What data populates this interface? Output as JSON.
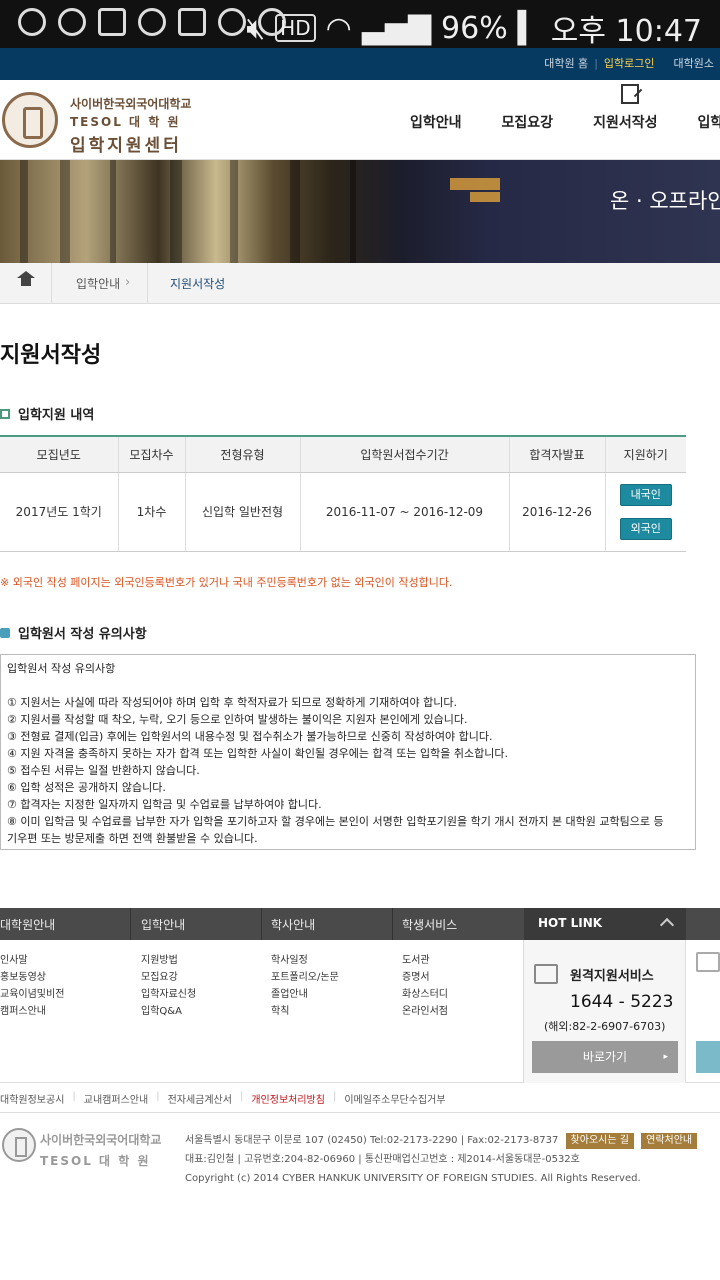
{
  "status_bar": {
    "battery": "96%",
    "time": "오후 10:47",
    "hd": "HD"
  },
  "topbar": {
    "links": [
      "대학원 홈",
      "입학로그인",
      "대학원소"
    ]
  },
  "header": {
    "logo_line1": "사이버한국외국어대학교",
    "logo_line2": "TESOL 대 학 원",
    "logo_line3": "입학지원센터",
    "nav": [
      "입학안내",
      "모집요강",
      "지원서작성",
      "입학상"
    ]
  },
  "banner": {
    "text": "온 · 오프라인"
  },
  "breadcrumb": {
    "item1": "입학안내",
    "item2": "지원서작성"
  },
  "page_title": "지원서작성",
  "section1": {
    "title": "입학지원 내역",
    "columns": [
      "모집년도",
      "모집차수",
      "전형유형",
      "입학원서접수기간",
      "합격자발표",
      "지원하기"
    ],
    "row": [
      "2017년도 1학기",
      "1차수",
      "신입학 일반전형",
      "2016-11-07 ~ 2016-12-09",
      "2016-12-26"
    ],
    "btn_domestic": "내국인",
    "btn_foreign": "외국인"
  },
  "notice": "※ 외국인 작성 페이지는 외국인등록번호가 있거나 국내 주민등록번호가 없는 외국인이 작성합니다.",
  "section2": {
    "title": "입학원서 작성 유의사항",
    "box_title": "입학원서 작성 유의사항",
    "items": [
      "① 지원서는 사실에 따라 작성되어야 하며 입학 후 학적자료가 되므로 정확하게 기재하여야 합니다.",
      "② 지원서를 작성할 때 착오, 누락, 오기 등으로 인하여 발생하는 불이익은 지원자 본인에게 있습니다.",
      "③ 전형료 결제(입금) 후에는 입학원서의 내용수정 및 접수취소가 불가능하므로 신중히 작성하여야 합니다.",
      "④ 지원 자격을 충족하지 못하는 자가 합격 또는 입학한 사실이 확인될 경우에는 합격 또는 입학을 취소합니다.",
      "⑤ 접수된 서류는 일절 반환하지 않습니다.",
      "⑥ 입학 성적은 공개하지 않습니다.",
      "⑦ 합격자는 지정한 일자까지 입학금 및 수업료를 납부하여야 합니다.",
      "⑧ 이미 입학금 및 수업료를 납부한 자가 입학을 포기하고자 할 경우에는 본인이 서명한 입학포기원을 학기 개시 전까지 본 대학원 교학팀으로 등",
      "기우편 또는 방문제출 하면 전액 환불받을 수 있습니다."
    ]
  },
  "footer": {
    "cols": [
      {
        "title": "대학원안내",
        "items": [
          "인사말",
          "홍보동영상",
          "교육이념및비전",
          "캠퍼스안내"
        ]
      },
      {
        "title": "입학안내",
        "items": [
          "지원방법",
          "모집요강",
          "입학자료신청",
          "입학Q&A"
        ]
      },
      {
        "title": "학사안내",
        "items": [
          "학사일정",
          "포트폴리오/논문",
          "졸업안내",
          "학칙"
        ]
      },
      {
        "title": "학생서비스",
        "items": [
          "도서관",
          "증명서",
          "화상스터디",
          "온라인서점"
        ]
      }
    ],
    "hotlink": "HOT LINK",
    "remote_title": "원격지원서비스",
    "remote_phone": "1644 - 5223",
    "remote_intl": "(해외:82-2-6907-6703)",
    "remote_btn": "바로가기",
    "links": [
      "대학원정보공시",
      "교내캠퍼스안내",
      "전자세금계산서",
      "개인정보처리방침",
      "이메일주소무단수집거부"
    ],
    "logo_line1": "사이버한국외국어대학교",
    "logo_line2": "TESOL 대 학 원",
    "address": "서울특별시 동대문구 이문로 107 (02450) Tel:02-2173-2290 | Fax:02-2173-8737",
    "btn_map": "찾아오시는 길",
    "btn_contact": "연락처안내",
    "reg": "대표:김인철 | 고유번호:204-82-06960 | 통신판매업신고번호 : 제2014-서울동대문-0532호",
    "copyright": "Copyright (c) 2014 CYBER HANKUK UNIVERSITY OF FOREIGN STUDIES. All Rights Reserved."
  }
}
